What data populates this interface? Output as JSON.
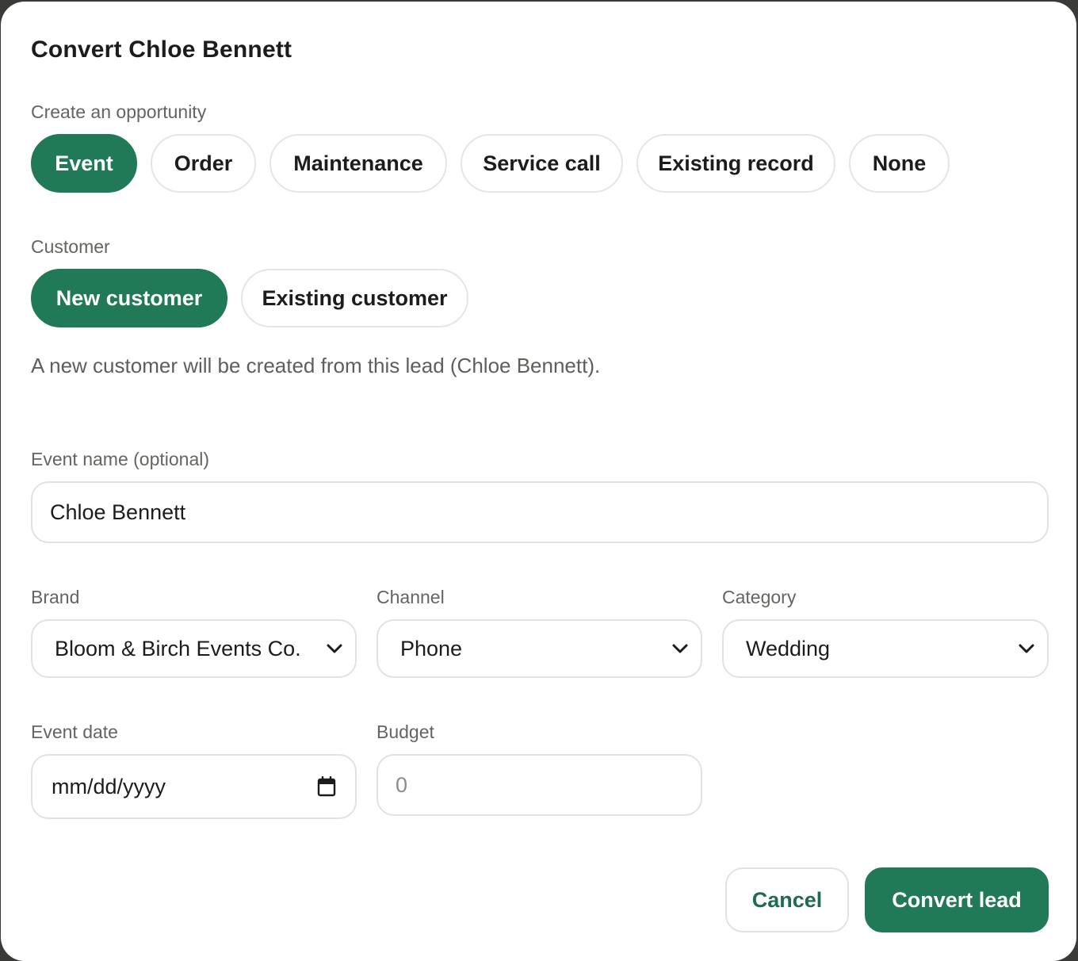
{
  "modal": {
    "title": "Convert Chloe Bennett"
  },
  "opportunity": {
    "label": "Create an opportunity",
    "options": [
      "Event",
      "Order",
      "Maintenance",
      "Service call",
      "Existing record",
      "None"
    ],
    "selected": "Event"
  },
  "customer": {
    "label": "Customer",
    "options": [
      "New customer",
      "Existing customer"
    ],
    "selected": "New customer",
    "helper_text": "A new customer will be created from this lead (Chloe Bennett)."
  },
  "event_name": {
    "label": "Event name (optional)",
    "value": "Chloe Bennett"
  },
  "brand": {
    "label": "Brand",
    "value": "Bloom & Birch Events Co.",
    "icon": "chevron-down-icon"
  },
  "channel": {
    "label": "Channel",
    "value": "Phone",
    "icon": "chevron-down-icon"
  },
  "category": {
    "label": "Category",
    "value": "Wedding",
    "icon": "chevron-down-icon"
  },
  "event_date": {
    "label": "Event date",
    "placeholder": "mm/dd/yyyy",
    "icon": "calendar-icon"
  },
  "budget": {
    "label": "Budget",
    "placeholder": "0"
  },
  "actions": {
    "cancel_label": "Cancel",
    "convert_label": "Convert lead"
  },
  "colors": {
    "accent": "#217a57",
    "accent_text": "#1e6b4e",
    "label_text": "#626660",
    "border": "#e3e2de"
  }
}
